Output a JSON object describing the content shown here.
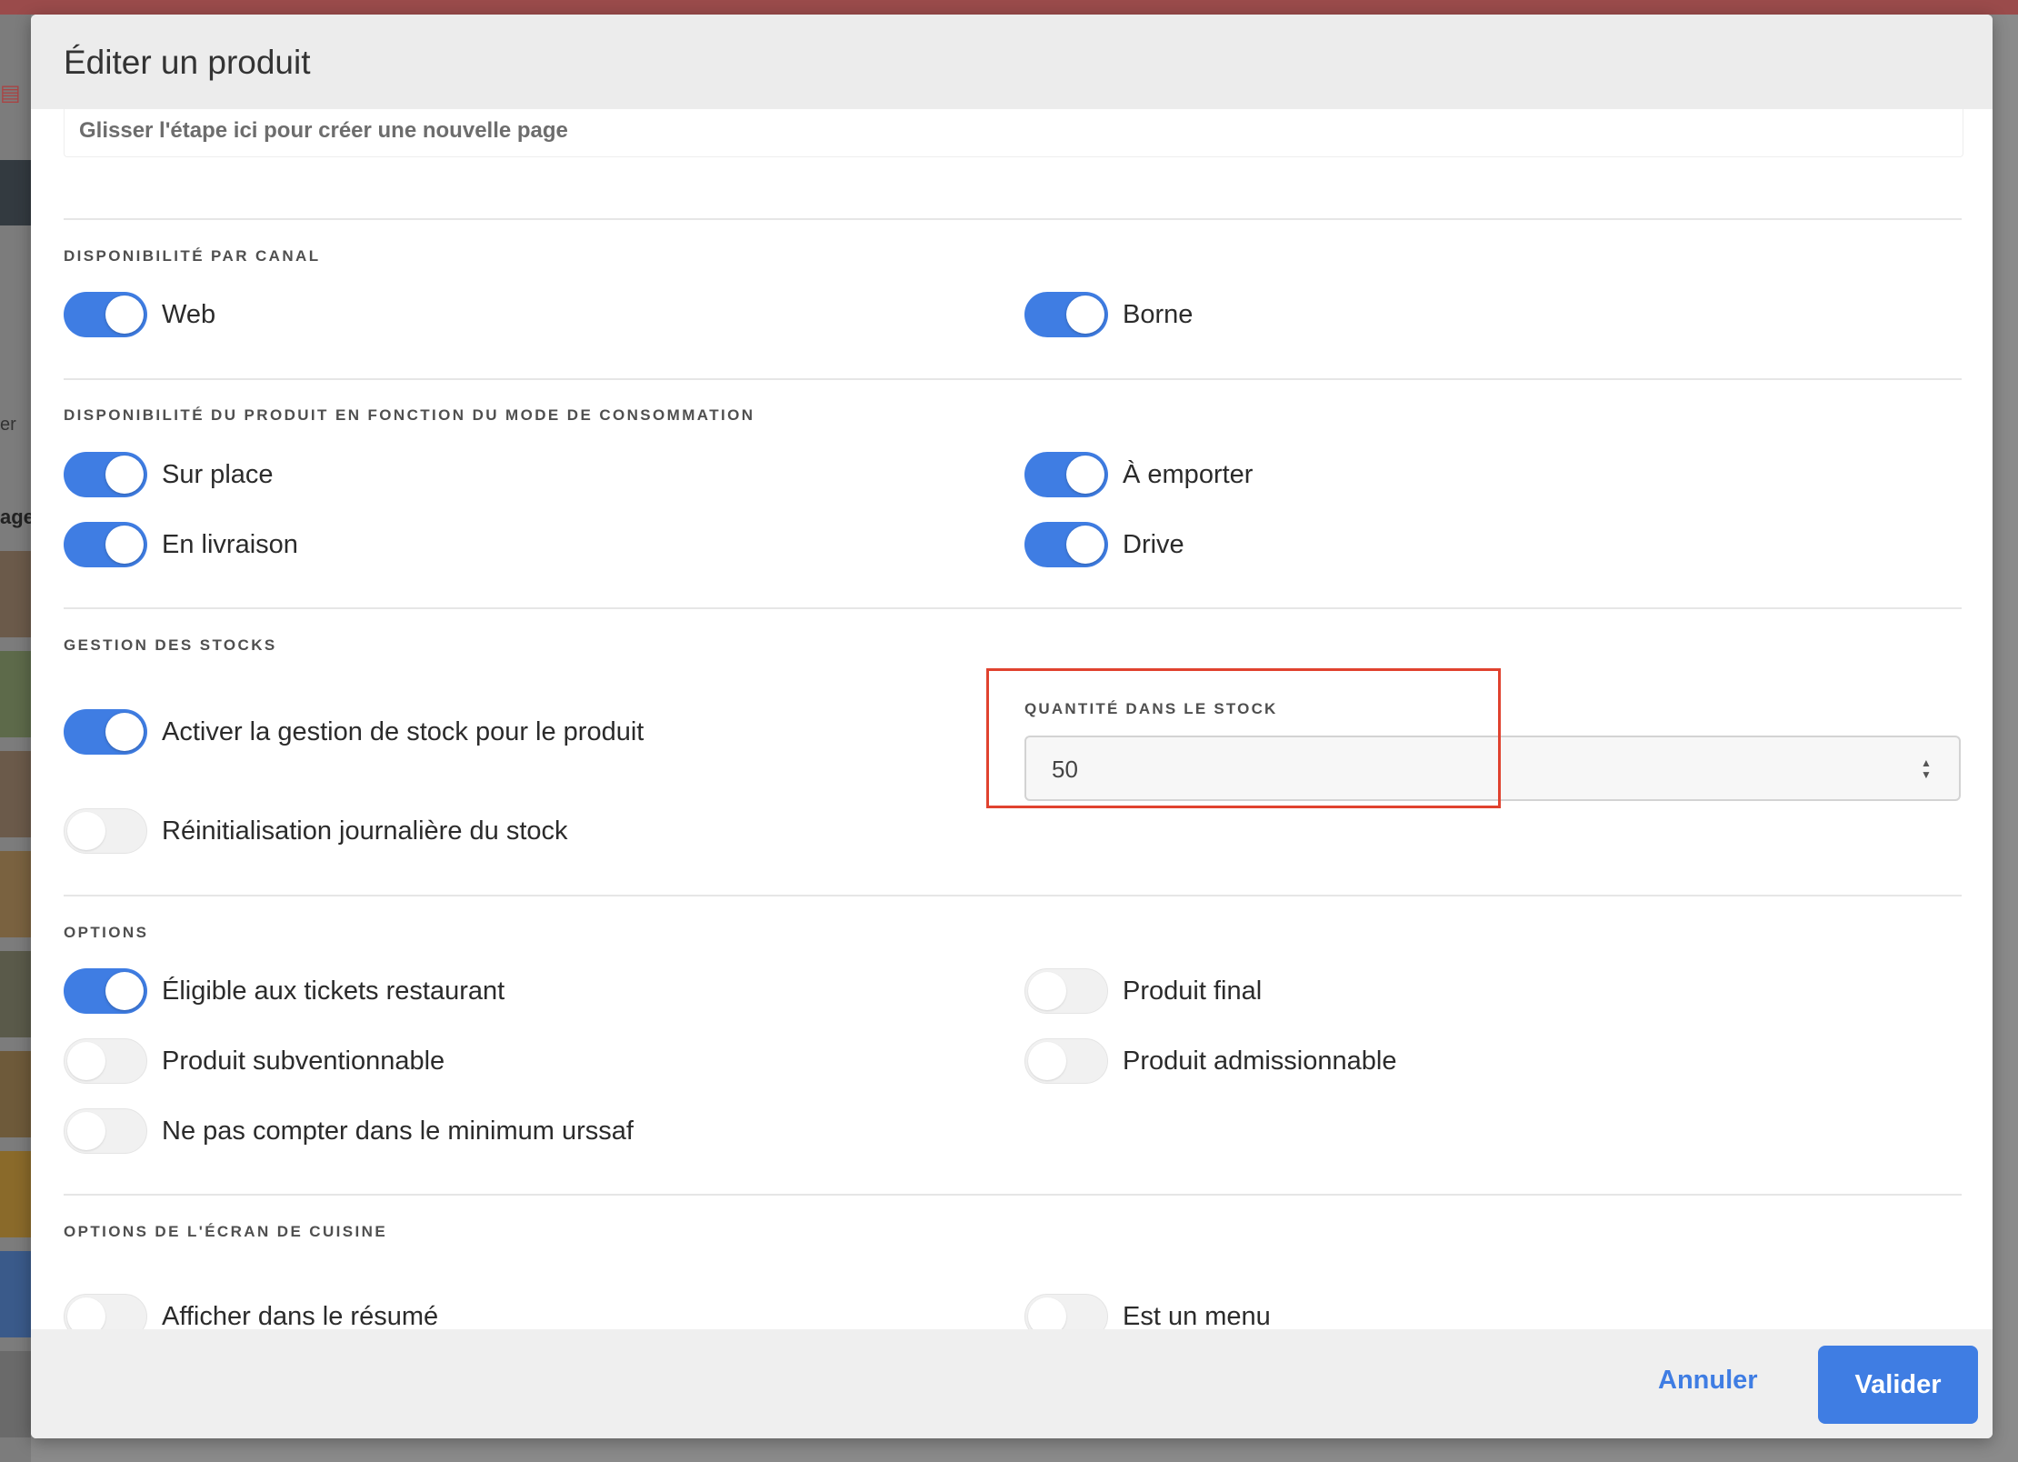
{
  "modal": {
    "title": "Éditer un produit",
    "drop_zone_text": "Glisser l'étape ici pour créer une nouvelle page"
  },
  "background": {
    "left_text_1": "er",
    "left_text_2": "age"
  },
  "sections": {
    "channel": {
      "title": "DISPONIBILITÉ PAR CANAL",
      "toggles": [
        {
          "label": "Web",
          "on": true
        },
        {
          "label": "Borne",
          "on": true
        }
      ]
    },
    "consumption": {
      "title": "DISPONIBILITÉ DU PRODUIT EN FONCTION DU MODE DE CONSOMMATION",
      "toggles": [
        {
          "label": "Sur place",
          "on": true
        },
        {
          "label": "À emporter",
          "on": true
        },
        {
          "label": "En livraison",
          "on": true
        },
        {
          "label": "Drive",
          "on": true
        }
      ]
    },
    "stock": {
      "title": "GESTION DES STOCKS",
      "toggles": [
        {
          "label": "Activer la gestion de stock pour le produit",
          "on": true
        },
        {
          "label": "Réinitialisation journalière du stock",
          "on": false
        }
      ],
      "quantity_label": "QUANTITÉ DANS LE STOCK",
      "quantity_value": "50"
    },
    "options": {
      "title": "OPTIONS",
      "toggles": [
        {
          "label": "Éligible aux tickets restaurant",
          "on": true
        },
        {
          "label": "Produit final",
          "on": false
        },
        {
          "label": "Produit subventionnable",
          "on": false
        },
        {
          "label": "Produit admissionnable",
          "on": false
        },
        {
          "label": "Ne pas compter dans le minimum urssaf",
          "on": false
        }
      ]
    },
    "kitchen": {
      "title": "OPTIONS DE L'ÉCRAN DE CUISINE",
      "toggles": [
        {
          "label": "Afficher dans le résumé",
          "on": false
        },
        {
          "label": "Est un menu",
          "on": false
        }
      ]
    }
  },
  "footer": {
    "cancel_label": "Annuler",
    "submit_label": "Valider"
  },
  "colors": {
    "accent": "#3f7de3",
    "highlight": "#e0422f"
  }
}
